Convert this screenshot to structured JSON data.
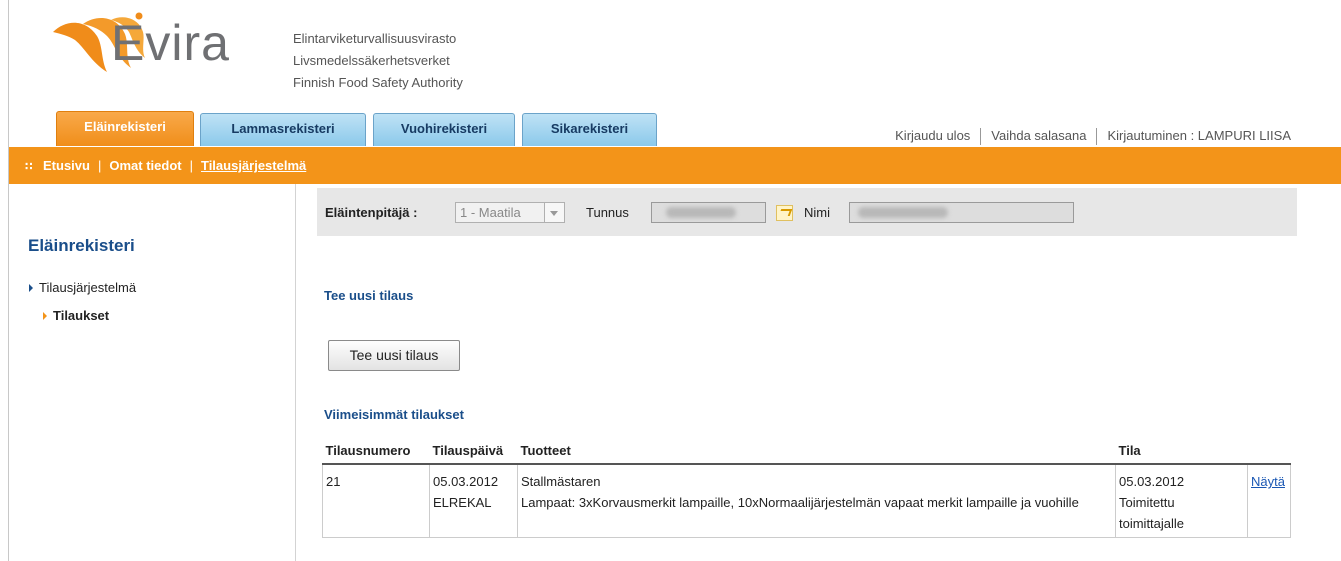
{
  "brand": {
    "name": "Evira",
    "agency_lines": [
      "Elintarviketurvallisuusvirasto",
      "Livsmedelssäkerhetsverket",
      "Finnish Food Safety Authority"
    ],
    "colors": {
      "orange": "#f39419",
      "logo_orange": "#f08c1a",
      "blue_tab": "#8bc9eb",
      "heading_blue": "#1a4e8a"
    }
  },
  "tabs": [
    {
      "label": "Eläinrekisteri",
      "active": true
    },
    {
      "label": "Lammasrekisteri",
      "active": false
    },
    {
      "label": "Vuohirekisteri",
      "active": false
    },
    {
      "label": "Sikarekisteri",
      "active": false
    }
  ],
  "top_links": {
    "logout": "Kirjaudu ulos",
    "change_password": "Vaihda salasana",
    "login_info": "Kirjautuminen : LAMPURI LIISA"
  },
  "breadcrumb": {
    "items": [
      "Etusivu",
      "Omat tiedot",
      "Tilausjärjestelmä"
    ],
    "separator": "|",
    "icon": "grid-dots-icon"
  },
  "sidebar": {
    "title": "Eläinrekisteri",
    "items": [
      {
        "label": "Tilausjärjestelmä",
        "level": 1
      },
      {
        "label": "Tilaukset",
        "level": 2
      }
    ]
  },
  "filter": {
    "keeper_label": "Eläintenpitäjä :",
    "keeper_value": "1 - Maatila",
    "id_label": "Tunnus",
    "name_label": "Nimi",
    "swap_icon": "change-arrow-icon"
  },
  "new_order": {
    "heading": "Tee uusi tilaus",
    "button": "Tee uusi tilaus"
  },
  "recent": {
    "heading": "Viimeisimmät tilaukset",
    "columns": [
      "Tilausnumero",
      "Tilauspäivä",
      "Tuotteet",
      "Tila",
      ""
    ],
    "rows": [
      {
        "number": "21",
        "date": "05.03.2012",
        "date_extra": "ELREKAL",
        "product_title": "Stallmästaren",
        "product_detail": "Lampaat: 3xKorvausmerkit lampaille, 10xNormaalijärjestelmän vapaat merkit lampaille ja vuohille",
        "status_date": "05.03.2012",
        "status_text": "Toimitettu toimittajalle",
        "action": "Näytä"
      }
    ]
  }
}
